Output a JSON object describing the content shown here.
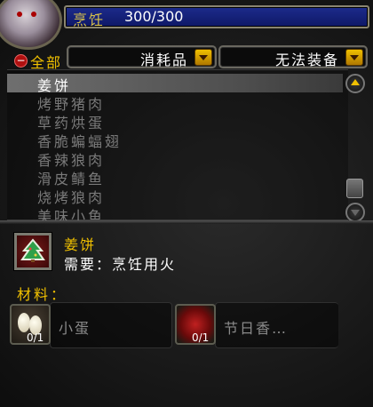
{
  "skill": {
    "name": "烹饪",
    "value": "300/300"
  },
  "filters": {
    "all_label": "全部",
    "collapse_glyph": "−",
    "category": "消耗品",
    "equip": "无法装备"
  },
  "recipes": [
    {
      "label": "姜饼",
      "selected": true
    },
    {
      "label": "烤野猪肉",
      "selected": false
    },
    {
      "label": "草药烘蛋",
      "selected": false
    },
    {
      "label": "香脆蝙蝠翅",
      "selected": false
    },
    {
      "label": "香辣狼肉",
      "selected": false
    },
    {
      "label": "滑皮鲭鱼",
      "selected": false
    },
    {
      "label": "烧烤狼肉",
      "selected": false
    },
    {
      "label": "美味小鱼",
      "selected": false
    }
  ],
  "detail": {
    "name": "姜饼",
    "requires": "需要：烹饪用火",
    "icon": "gingerbread-tree-icon"
  },
  "materials_title": "材料：",
  "reagents": [
    {
      "name": "小蛋",
      "count": "0/1",
      "icon": "eggs-icon"
    },
    {
      "name": "节日香…",
      "count": "0/1",
      "icon": "red-fruit-icon"
    }
  ],
  "colors": {
    "gold": "#f0c000",
    "skill_bar": "#1d2b8c",
    "selected_row": "#6f6f6f"
  }
}
